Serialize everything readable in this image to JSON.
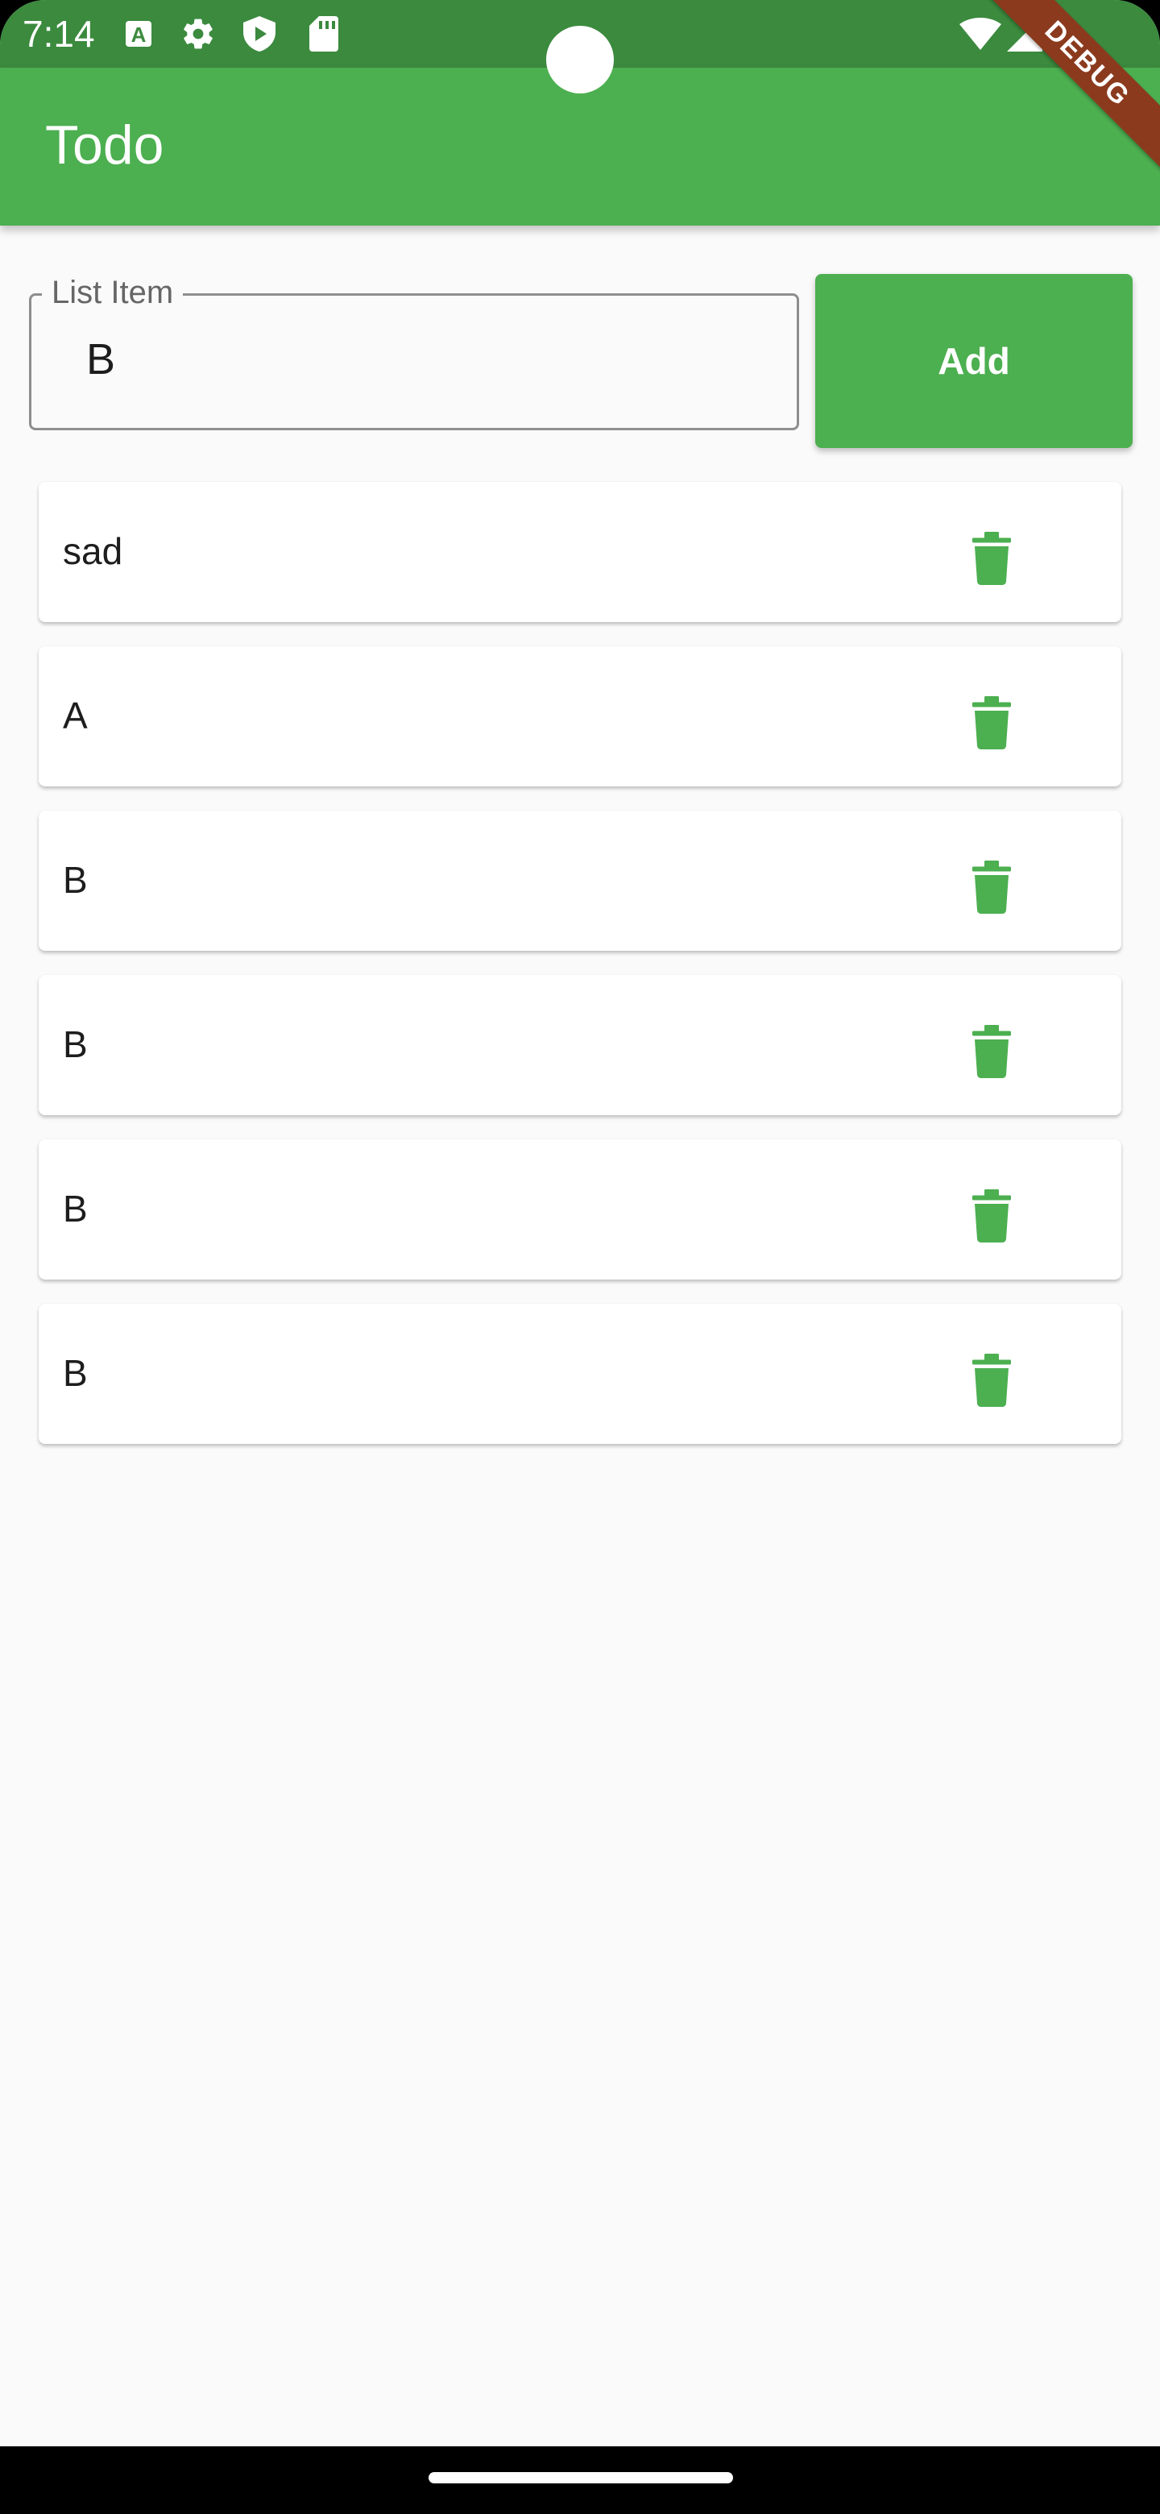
{
  "status_bar": {
    "time": "7:14",
    "icons": [
      "a-letter-icon",
      "gear-icon",
      "shield-play-icon",
      "sd-card-icon",
      "wifi-icon",
      "cell-signal-icon"
    ]
  },
  "app_bar": {
    "title": "Todo",
    "color": "#4caf50"
  },
  "debug_banner": {
    "label": "DEBUG"
  },
  "input": {
    "label": "List Item",
    "value": "B"
  },
  "add_button": {
    "label": "Add"
  },
  "list": {
    "items": [
      {
        "label": "sad",
        "icon": "trash-icon"
      },
      {
        "label": "A",
        "icon": "trash-icon"
      },
      {
        "label": "B",
        "icon": "trash-icon"
      },
      {
        "label": "B",
        "icon": "trash-icon"
      },
      {
        "label": "B",
        "icon": "trash-icon"
      },
      {
        "label": "B",
        "icon": "trash-icon"
      }
    ]
  },
  "colors": {
    "accent": "#4caf50",
    "status_bar": "#3b8a3e",
    "background": "#fafafa"
  }
}
